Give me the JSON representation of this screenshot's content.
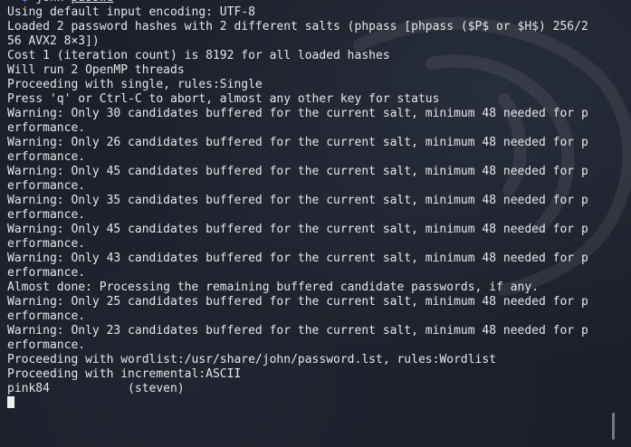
{
  "prompt": {
    "corner": "└─",
    "dollar": "$",
    "command": "john",
    "argument": "passwd"
  },
  "output_lines": [
    "Using default input encoding: UTF-8",
    "Loaded 2 password hashes with 2 different salts (phpass [phpass ($P$ or $H$) 256/2",
    "56 AVX2 8×3])",
    "Cost 1 (iteration count) is 8192 for all loaded hashes",
    "Will run 2 OpenMP threads",
    "Proceeding with single, rules:Single",
    "Press 'q' or Ctrl-C to abort, almost any other key for status",
    "Warning: Only 30 candidates buffered for the current salt, minimum 48 needed for p",
    "erformance.",
    "Warning: Only 26 candidates buffered for the current salt, minimum 48 needed for p",
    "erformance.",
    "Warning: Only 45 candidates buffered for the current salt, minimum 48 needed for p",
    "erformance.",
    "Warning: Only 35 candidates buffered for the current salt, minimum 48 needed for p",
    "erformance.",
    "Warning: Only 45 candidates buffered for the current salt, minimum 48 needed for p",
    "erformance.",
    "Warning: Only 43 candidates buffered for the current salt, minimum 48 needed for p",
    "erformance.",
    "Almost done: Processing the remaining buffered candidate passwords, if any.",
    "Warning: Only 25 candidates buffered for the current salt, minimum 48 needed for p",
    "erformance.",
    "Warning: Only 23 candidates buffered for the current salt, minimum 48 needed for p",
    "erformance.",
    "Proceeding with wordlist:/usr/share/john/password.lst, rules:Wordlist",
    "Proceeding with incremental:ASCII",
    "pink84           (steven)"
  ],
  "colors": {
    "background": "#1c1f29",
    "text": "#e6e6e6",
    "prompt": "#4a8cd6"
  }
}
